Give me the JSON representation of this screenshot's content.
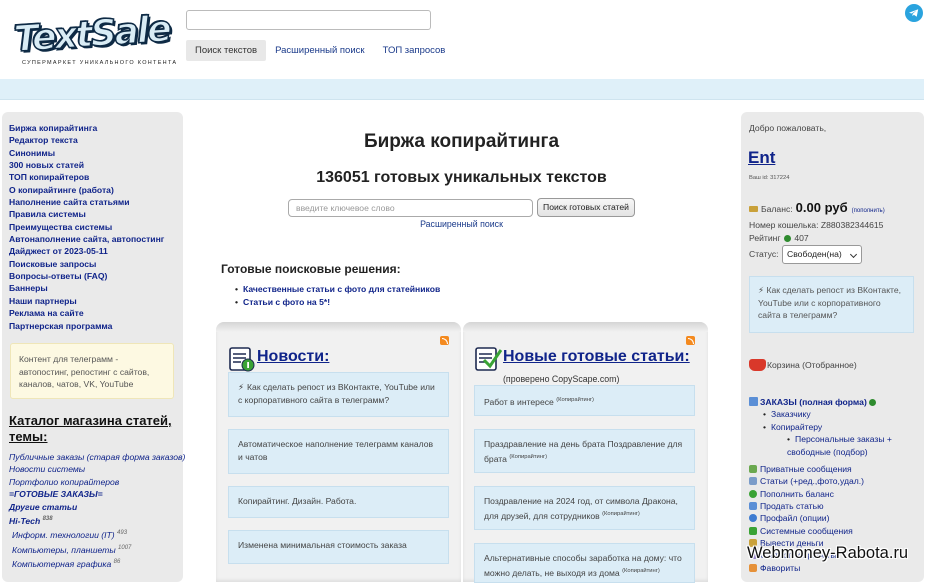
{
  "header": {
    "logo_text": "TextSale",
    "logo_sub": "СУПЕРМАРКЕТ УНИКАЛЬНОГО КОНТЕНТА",
    "nav": [
      {
        "label": "Поиск текстов"
      },
      {
        "label": "Расширенный поиск"
      },
      {
        "label": "ТОП запросов"
      }
    ]
  },
  "left": {
    "menu": [
      "Биржа копирайтинга",
      "Редактор текста",
      "Синонимы",
      "300 новых статей",
      "ТОП копирайтеров",
      "О копирайтинге (работа)",
      "Наполнение сайта статьями",
      "Правила системы",
      "Преимущества системы",
      "Автонаполнение сайта, автопостинг",
      "Дайджест от 2023-05-11",
      "Поисковые запросы",
      "Вопросы-ответы (FAQ)",
      "Баннеры",
      "Наши партнеры",
      "Реклама на сайте",
      "Партнерская программа"
    ],
    "promo": "Контент для телеграмм - автопостинг, репостинг с сайтов, каналов, чатов, VK, YouTube",
    "catalog_title": "Каталог магазина статей, темы:",
    "catalog": [
      {
        "label": "Публичные заказы (старая форма заказов)",
        "bold": false
      },
      {
        "label": "Новости системы",
        "bold": false
      },
      {
        "label": "Портфолио копирайтеров",
        "bold": false
      },
      {
        "label": "=ГОТОВЫЕ ЗАКАЗЫ=",
        "bold": true
      },
      {
        "label": "Другие статьи",
        "bold": true
      },
      {
        "label": "Hi-Tech",
        "bold": true,
        "count": "838"
      },
      {
        "label": "Информ. технологии (IT)",
        "bold": false,
        "count": "493",
        "sub": true
      },
      {
        "label": "Компьютеры, планшеты",
        "bold": false,
        "count": "1007",
        "sub": true
      },
      {
        "label": "Компьютерная графика",
        "bold": false,
        "count": "86",
        "sub": true
      }
    ]
  },
  "center": {
    "title": "Биржа копирайтинга",
    "subtitle": "136051 готовых уникальных текстов",
    "search_placeholder": "введите ключевое слово",
    "search_button": "Поиск готовых статей",
    "advanced_link": "Расширенный поиск",
    "ready_title": "Готовые поисковые решения:",
    "ready_items": [
      "Качественные статьи с фото для статейников",
      "Статьи с фото на 5*!"
    ],
    "news": {
      "title": "Новости:",
      "items": [
        "Как сделать репост из ВКонтакте, YouTube или с корпоративного сайта в телеграмм?",
        "Автоматическое наполнение телеграмм каналов и чатов",
        "Копирайтинг. Дизайн. Работа.",
        "Изменена минимальная стоимость заказа"
      ]
    },
    "articles": {
      "title": "Новые готовые статьи:",
      "note": "(проверено CopyScape.com)",
      "tag": "(Копирайтинг)",
      "items": [
        "Работ в интересе",
        "Праздравление на день брата Поздравление для брата",
        "Поздравление на 2024 год, от символа Дракона, для друзей, для сотрудников",
        "Альтернативные способы заработка на дому: что можно делать, не выходя из дома"
      ]
    }
  },
  "right": {
    "welcome": "Добро пожаловать,",
    "username": "Ent",
    "user_id": "Ваш id: 317224",
    "balance_label": "Баланс:",
    "balance_value": "0.00 руб",
    "refill": "(пополнить)",
    "wallet": "Номер кошелька: Z880382344615",
    "rating_label": "Рейтинг",
    "rating_value": "407",
    "status_label": "Статус:",
    "status_value": "Свободен(на)",
    "promo": "Как сделать репост из ВКонтакте, YouTube или с корпоративного сайта в телеграмм?",
    "cart": "Корзина (Отобранное)",
    "orders_title": "ЗАКАЗЫ (полная форма)",
    "orders_sub": [
      "Заказчику",
      "Копирайтеру"
    ],
    "orders_sub2": [
      "Персональные заказы + свободные (подбор)"
    ],
    "menu": [
      "Приватные сообщения",
      "Статьи (+ред.,фото,удал.)",
      "Пополнить баланс",
      "Продать статью",
      "Профайл (опции)",
      "Системные сообщения",
      "Вывести деньги",
      "Статистика работы",
      "Фавориты"
    ]
  },
  "watermark": "Webmoney-Rabota.ru",
  "colors": {
    "link": "#10248a",
    "card_bg": "#dcedf7",
    "promo_bg": "#fdf9e2",
    "header_bar": "#dff0f9"
  }
}
